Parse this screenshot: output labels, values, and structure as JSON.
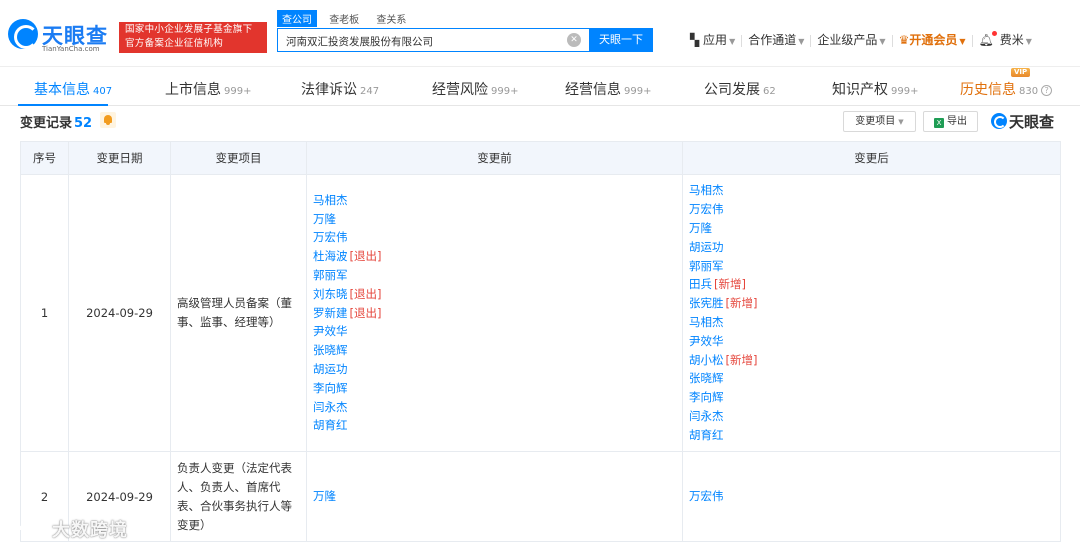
{
  "brand": {
    "name": "天眼查",
    "domain": "TianYanCha.com",
    "gov_badge_line1": "国家中小企业发展子基金旗下",
    "gov_badge_line2": "官方备案企业征信机构"
  },
  "search": {
    "tabs": [
      "查公司",
      "查老板",
      "查关系"
    ],
    "active_tab": 0,
    "value": "河南双汇投资发展股份有限公司",
    "clear_glyph": "✕",
    "button": "天眼一下"
  },
  "topnav": {
    "app": "应用",
    "partner": "合作通道",
    "enterprise": "企业级产品",
    "vip": "开通会员",
    "user": "费米"
  },
  "tabs": [
    {
      "label": "基本信息",
      "count": "407"
    },
    {
      "label": "上市信息",
      "count": "999+"
    },
    {
      "label": "法律诉讼",
      "count": "247"
    },
    {
      "label": "经营风险",
      "count": "999+"
    },
    {
      "label": "经营信息",
      "count": "999+"
    },
    {
      "label": "公司发展",
      "count": "62"
    },
    {
      "label": "知识产权",
      "count": "999+"
    },
    {
      "label": "历史信息",
      "count": "830"
    }
  ],
  "vip_tag": "VIP",
  "help_glyph": "?",
  "section": {
    "title": "变更记录",
    "count": "52",
    "filter_button": "变更项目",
    "export_button": "导出",
    "brand_mark": "天眼查"
  },
  "table": {
    "headers": [
      "序号",
      "变更日期",
      "变更项目",
      "变更前",
      "变更后"
    ],
    "rows": [
      {
        "index": "1",
        "date": "2024-09-29",
        "item": "高级管理人员备案（董事、监事、经理等）",
        "before": [
          {
            "name": "马相杰",
            "tag": ""
          },
          {
            "name": "万隆",
            "tag": ""
          },
          {
            "name": "万宏伟",
            "tag": ""
          },
          {
            "name": "杜海波",
            "tag": "[退出]"
          },
          {
            "name": "郭丽军",
            "tag": ""
          },
          {
            "name": "刘东晓",
            "tag": "[退出]"
          },
          {
            "name": "罗新建",
            "tag": "[退出]"
          },
          {
            "name": "尹效华",
            "tag": ""
          },
          {
            "name": "张晓辉",
            "tag": ""
          },
          {
            "name": "胡运功",
            "tag": ""
          },
          {
            "name": "李向辉",
            "tag": ""
          },
          {
            "name": "闫永杰",
            "tag": ""
          },
          {
            "name": "胡育红",
            "tag": ""
          }
        ],
        "after": [
          {
            "name": "马相杰",
            "tag": ""
          },
          {
            "name": "万宏伟",
            "tag": ""
          },
          {
            "name": "万隆",
            "tag": ""
          },
          {
            "name": "胡运功",
            "tag": ""
          },
          {
            "name": "郭丽军",
            "tag": ""
          },
          {
            "name": "田兵",
            "tag": "[新增]"
          },
          {
            "name": "张宪胜",
            "tag": "[新增]"
          },
          {
            "name": "马相杰",
            "tag": ""
          },
          {
            "name": "尹效华",
            "tag": ""
          },
          {
            "name": "胡小松",
            "tag": "[新增]"
          },
          {
            "name": "张晓辉",
            "tag": ""
          },
          {
            "name": "李向辉",
            "tag": ""
          },
          {
            "name": "闫永杰",
            "tag": ""
          },
          {
            "name": "胡育红",
            "tag": ""
          }
        ]
      },
      {
        "index": "2",
        "date": "2024-09-29",
        "item": "负责人变更（法定代表人、负责人、首席代表、合伙事务执行人等变更）",
        "before_single": "万隆",
        "after_single": "万宏伟"
      }
    ]
  },
  "watermark": "大数跨境",
  "colors": {
    "primary": "#0084ff",
    "vip": "#e0700c",
    "tag_red": "#e5463c",
    "header_bg": "#f2f6fc"
  }
}
